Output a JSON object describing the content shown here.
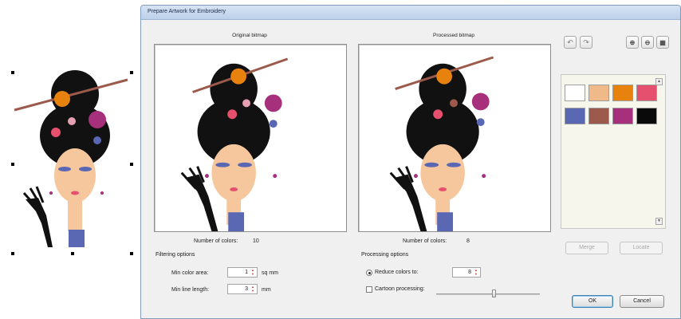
{
  "dialog": {
    "title": "Prepare Artwork for Embroidery",
    "original_label": "Original bitmap",
    "processed_label": "Processed bitmap",
    "original_colors_label": "Number of colors:",
    "original_colors_value": "10",
    "processed_colors_label": "Number of colors:",
    "processed_colors_value": "8"
  },
  "filtering": {
    "group_label": "Filtering options",
    "min_area_label": "Min color area:",
    "min_area_value": "1",
    "min_area_unit": "sq mm",
    "min_line_label": "Min line length:",
    "min_line_value": "3",
    "min_line_unit": "mm"
  },
  "processing": {
    "group_label": "Processing options",
    "reduce_label": "Reduce colors to:",
    "reduce_value": "8",
    "reduce_selected": true,
    "cartoon_label": "Cartoon processing:",
    "cartoon_checked": false
  },
  "toolbar": {
    "undo_icon": "undo-icon",
    "redo_icon": "redo-icon",
    "zoom_in_icon": "zoom-in-icon",
    "zoom_out_icon": "zoom-out-icon",
    "zoom_fit_icon": "zoom-fit-icon"
  },
  "palette": {
    "colors": [
      "#ffffff",
      "#f0b98a",
      "#e8820f",
      "#e5506f",
      "#5a67b3",
      "#9c5a4c",
      "#a6307b",
      "#0a0a0a"
    ]
  },
  "buttons": {
    "merge": "Merge",
    "locate": "Locate",
    "ok": "OK",
    "cancel": "Cancel"
  }
}
